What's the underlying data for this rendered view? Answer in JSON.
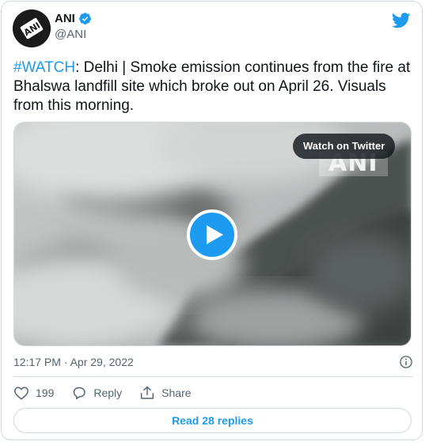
{
  "author": {
    "name": "ANI",
    "handle": "@ANI",
    "avatar_text": "ANI"
  },
  "tweet": {
    "hashtag": "#WATCH",
    "body": ": Delhi | Smoke emission continues from the fire at Bhalswa landfill site which broke out on April 26. Visuals from this morning."
  },
  "media": {
    "watch_label": "Watch on Twitter",
    "watermark": "ANI"
  },
  "meta": {
    "timestamp": "12:17 PM · Apr 29, 2022"
  },
  "actions": {
    "like_count": "199",
    "reply_label": "Reply",
    "share_label": "Share"
  },
  "footer": {
    "read_replies": "Read 28 replies"
  },
  "colors": {
    "accent": "#1d9bf0",
    "text_primary": "#0f1419",
    "text_secondary": "#536471",
    "border": "#cfd9de"
  }
}
